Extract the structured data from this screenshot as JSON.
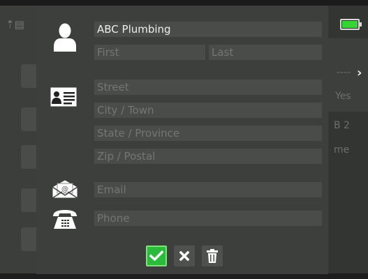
{
  "background": {
    "right_labels": [
      "----",
      "Yes",
      "B 2",
      "me"
    ]
  },
  "contact": {
    "name": {
      "value": "ABC Plumbing",
      "placeholder": ""
    },
    "first": {
      "value": "",
      "placeholder": "First"
    },
    "last": {
      "value": "",
      "placeholder": "Last"
    },
    "street": {
      "value": "",
      "placeholder": "Street"
    },
    "city": {
      "value": "",
      "placeholder": "City / Town"
    },
    "state": {
      "value": "",
      "placeholder": "State / Province"
    },
    "zip": {
      "value": "",
      "placeholder": "Zip / Postal"
    },
    "email": {
      "value": "",
      "placeholder": "Email"
    },
    "phone": {
      "value": "",
      "placeholder": "Phone"
    }
  },
  "icons": {
    "person": "person-icon",
    "address": "address-card-icon",
    "email": "envelope-icon",
    "phone": "telephone-icon",
    "confirm": "checkmark-icon",
    "cancel": "close-icon",
    "delete": "trash-icon",
    "battery": "battery-icon"
  },
  "colors": {
    "confirm_green": "#2bba3b",
    "battery_green": "#35d534",
    "dialog_bg": "#3d3f3d",
    "field_bg": "#4a4c4a"
  }
}
